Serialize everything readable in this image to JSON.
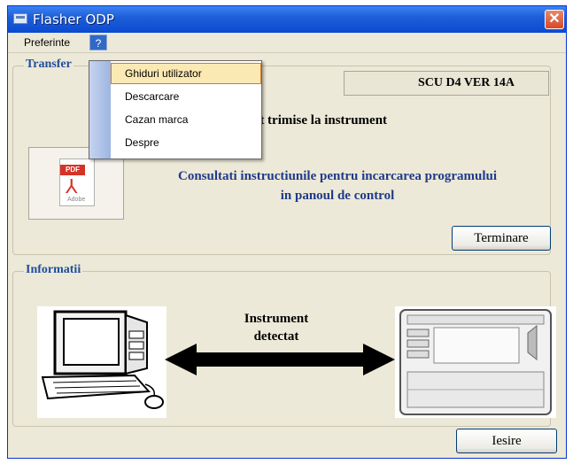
{
  "window": {
    "title": "Flasher ODP",
    "close_label": "✕"
  },
  "menubar": {
    "preferinte": "Preferinte",
    "help": "?"
  },
  "dropdown": {
    "items": [
      {
        "label": "Ghiduri utilizator",
        "highlighted": true
      },
      {
        "label": "Descarcare"
      },
      {
        "label": "Cazan marca"
      },
      {
        "label": "Despre"
      }
    ]
  },
  "transfer": {
    "title": "Transfer",
    "version": "SCU D4 VER  14A",
    "status_text": "ect trimise la instrument",
    "pdf_tag": "PDF",
    "pdf_brand": "Adobe",
    "consult_line1": "Consultati instructiunile pentru incarcarea programului",
    "consult_line2": "in panoul de control",
    "terminare_label": "Terminare"
  },
  "info": {
    "title": "Informatii",
    "detect_line1": "Instrument",
    "detect_line2": "detectat",
    "iesire_label": "Iesire"
  },
  "colors": {
    "titlebar": "#0a4ad0",
    "group_title": "#1f4e9a",
    "consult_text": "#1f3a8a",
    "menu_highlight": "#fbe9b3"
  }
}
